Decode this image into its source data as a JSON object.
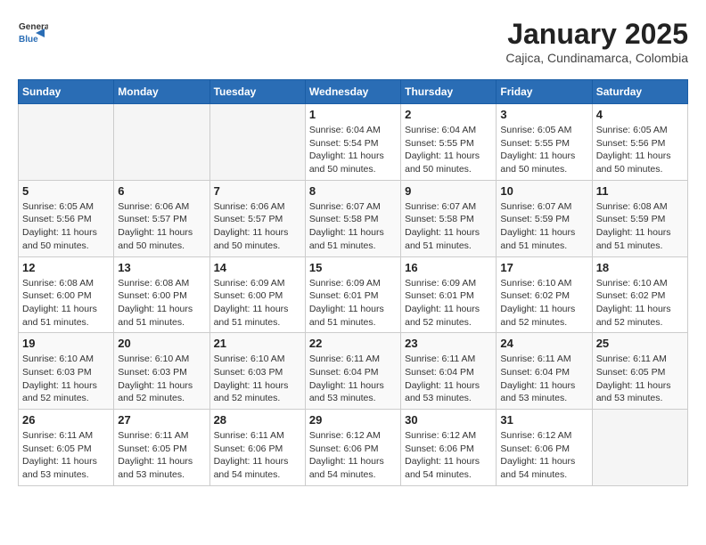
{
  "header": {
    "logo_general": "General",
    "logo_blue": "Blue",
    "month": "January 2025",
    "location": "Cajica, Cundinamarca, Colombia"
  },
  "days_of_week": [
    "Sunday",
    "Monday",
    "Tuesday",
    "Wednesday",
    "Thursday",
    "Friday",
    "Saturday"
  ],
  "weeks": [
    [
      {
        "day": "",
        "info": ""
      },
      {
        "day": "",
        "info": ""
      },
      {
        "day": "",
        "info": ""
      },
      {
        "day": "1",
        "info": "Sunrise: 6:04 AM\nSunset: 5:54 PM\nDaylight: 11 hours and 50 minutes."
      },
      {
        "day": "2",
        "info": "Sunrise: 6:04 AM\nSunset: 5:55 PM\nDaylight: 11 hours and 50 minutes."
      },
      {
        "day": "3",
        "info": "Sunrise: 6:05 AM\nSunset: 5:55 PM\nDaylight: 11 hours and 50 minutes."
      },
      {
        "day": "4",
        "info": "Sunrise: 6:05 AM\nSunset: 5:56 PM\nDaylight: 11 hours and 50 minutes."
      }
    ],
    [
      {
        "day": "5",
        "info": "Sunrise: 6:05 AM\nSunset: 5:56 PM\nDaylight: 11 hours and 50 minutes."
      },
      {
        "day": "6",
        "info": "Sunrise: 6:06 AM\nSunset: 5:57 PM\nDaylight: 11 hours and 50 minutes."
      },
      {
        "day": "7",
        "info": "Sunrise: 6:06 AM\nSunset: 5:57 PM\nDaylight: 11 hours and 50 minutes."
      },
      {
        "day": "8",
        "info": "Sunrise: 6:07 AM\nSunset: 5:58 PM\nDaylight: 11 hours and 51 minutes."
      },
      {
        "day": "9",
        "info": "Sunrise: 6:07 AM\nSunset: 5:58 PM\nDaylight: 11 hours and 51 minutes."
      },
      {
        "day": "10",
        "info": "Sunrise: 6:07 AM\nSunset: 5:59 PM\nDaylight: 11 hours and 51 minutes."
      },
      {
        "day": "11",
        "info": "Sunrise: 6:08 AM\nSunset: 5:59 PM\nDaylight: 11 hours and 51 minutes."
      }
    ],
    [
      {
        "day": "12",
        "info": "Sunrise: 6:08 AM\nSunset: 6:00 PM\nDaylight: 11 hours and 51 minutes."
      },
      {
        "day": "13",
        "info": "Sunrise: 6:08 AM\nSunset: 6:00 PM\nDaylight: 11 hours and 51 minutes."
      },
      {
        "day": "14",
        "info": "Sunrise: 6:09 AM\nSunset: 6:00 PM\nDaylight: 11 hours and 51 minutes."
      },
      {
        "day": "15",
        "info": "Sunrise: 6:09 AM\nSunset: 6:01 PM\nDaylight: 11 hours and 51 minutes."
      },
      {
        "day": "16",
        "info": "Sunrise: 6:09 AM\nSunset: 6:01 PM\nDaylight: 11 hours and 52 minutes."
      },
      {
        "day": "17",
        "info": "Sunrise: 6:10 AM\nSunset: 6:02 PM\nDaylight: 11 hours and 52 minutes."
      },
      {
        "day": "18",
        "info": "Sunrise: 6:10 AM\nSunset: 6:02 PM\nDaylight: 11 hours and 52 minutes."
      }
    ],
    [
      {
        "day": "19",
        "info": "Sunrise: 6:10 AM\nSunset: 6:03 PM\nDaylight: 11 hours and 52 minutes."
      },
      {
        "day": "20",
        "info": "Sunrise: 6:10 AM\nSunset: 6:03 PM\nDaylight: 11 hours and 52 minutes."
      },
      {
        "day": "21",
        "info": "Sunrise: 6:10 AM\nSunset: 6:03 PM\nDaylight: 11 hours and 52 minutes."
      },
      {
        "day": "22",
        "info": "Sunrise: 6:11 AM\nSunset: 6:04 PM\nDaylight: 11 hours and 53 minutes."
      },
      {
        "day": "23",
        "info": "Sunrise: 6:11 AM\nSunset: 6:04 PM\nDaylight: 11 hours and 53 minutes."
      },
      {
        "day": "24",
        "info": "Sunrise: 6:11 AM\nSunset: 6:04 PM\nDaylight: 11 hours and 53 minutes."
      },
      {
        "day": "25",
        "info": "Sunrise: 6:11 AM\nSunset: 6:05 PM\nDaylight: 11 hours and 53 minutes."
      }
    ],
    [
      {
        "day": "26",
        "info": "Sunrise: 6:11 AM\nSunset: 6:05 PM\nDaylight: 11 hours and 53 minutes."
      },
      {
        "day": "27",
        "info": "Sunrise: 6:11 AM\nSunset: 6:05 PM\nDaylight: 11 hours and 53 minutes."
      },
      {
        "day": "28",
        "info": "Sunrise: 6:11 AM\nSunset: 6:06 PM\nDaylight: 11 hours and 54 minutes."
      },
      {
        "day": "29",
        "info": "Sunrise: 6:12 AM\nSunset: 6:06 PM\nDaylight: 11 hours and 54 minutes."
      },
      {
        "day": "30",
        "info": "Sunrise: 6:12 AM\nSunset: 6:06 PM\nDaylight: 11 hours and 54 minutes."
      },
      {
        "day": "31",
        "info": "Sunrise: 6:12 AM\nSunset: 6:06 PM\nDaylight: 11 hours and 54 minutes."
      },
      {
        "day": "",
        "info": ""
      }
    ]
  ]
}
